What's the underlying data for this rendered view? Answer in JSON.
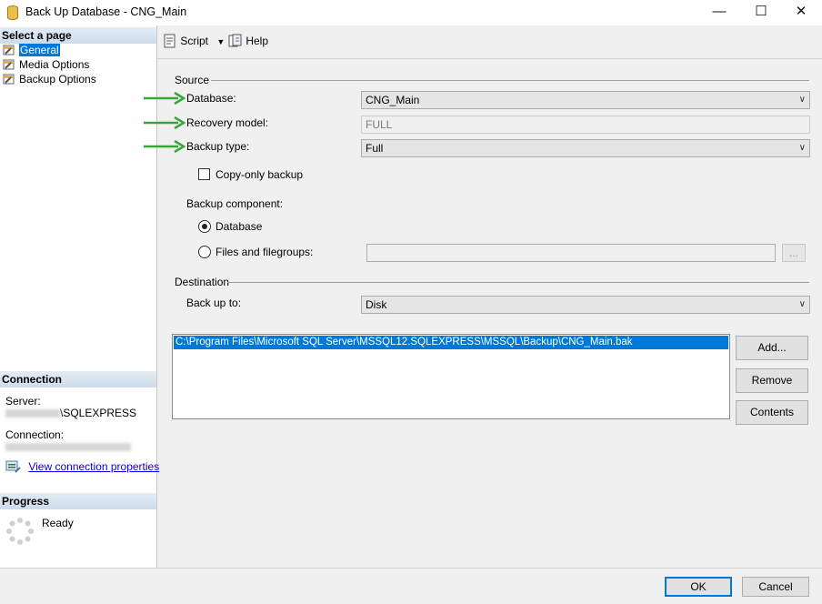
{
  "window": {
    "title": "Back Up Database - CNG_Main"
  },
  "left": {
    "select_page_header": "Select a page",
    "pages": [
      {
        "label": "General"
      },
      {
        "label": "Media Options"
      },
      {
        "label": "Backup Options"
      }
    ],
    "connection_header": "Connection",
    "server_label": "Server:",
    "server_value": "\\SQLEXPRESS",
    "connection_label": "Connection:",
    "view_props_link": "View connection properties",
    "progress_header": "Progress",
    "progress_status": "Ready"
  },
  "toolbar": {
    "script_label": "Script",
    "help_label": "Help"
  },
  "source": {
    "group_label": "Source",
    "database_label": "Database:",
    "database_value": "CNG_Main",
    "recovery_label": "Recovery model:",
    "recovery_value": "FULL",
    "backup_type_label": "Backup type:",
    "backup_type_value": "Full",
    "copy_only_label": "Copy-only backup",
    "component_label": "Backup component:",
    "radio_database_label": "Database",
    "radio_files_label": "Files and filegroups:",
    "files_browse_label": "..."
  },
  "destination": {
    "group_label": "Destination",
    "backup_to_label": "Back up to:",
    "backup_to_value": "Disk",
    "paths": [
      "C:\\Program Files\\Microsoft SQL Server\\MSSQL12.SQLEXPRESS\\MSSQL\\Backup\\CNG_Main.bak"
    ],
    "add_label": "Add...",
    "remove_label": "Remove",
    "contents_label": "Contents"
  },
  "footer": {
    "ok_label": "OK",
    "cancel_label": "Cancel"
  },
  "colors": {
    "selection": "#0078d7",
    "arrow": "#3aa53a",
    "link": "#0000ee"
  }
}
